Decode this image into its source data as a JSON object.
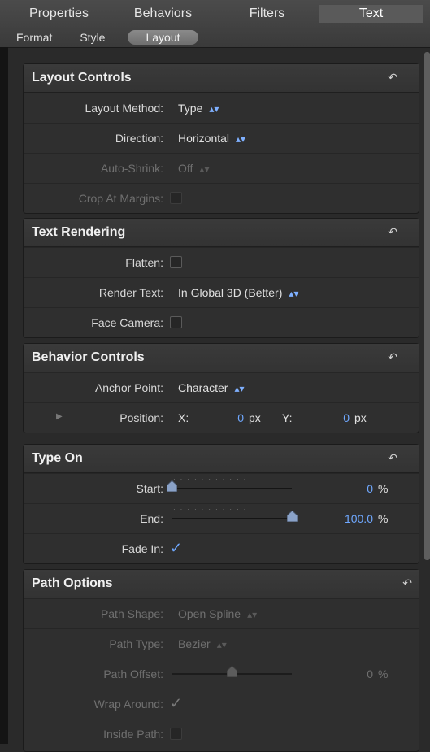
{
  "tabs": [
    "Properties",
    "Behaviors",
    "Filters",
    "Text"
  ],
  "active_tab": 3,
  "subtabs": [
    "Format",
    "Style",
    "Layout"
  ],
  "active_subtab": 2,
  "layout_controls": {
    "title": "Layout Controls",
    "layout_method": {
      "label": "Layout Method:",
      "value": "Type"
    },
    "direction": {
      "label": "Direction:",
      "value": "Horizontal"
    },
    "auto_shrink": {
      "label": "Auto-Shrink:",
      "value": "Off"
    },
    "crop_at_margins": {
      "label": "Crop At Margins:",
      "checked": false
    }
  },
  "text_rendering": {
    "title": "Text Rendering",
    "flatten": {
      "label": "Flatten:",
      "checked": false
    },
    "render_text": {
      "label": "Render Text:",
      "value": "In Global 3D (Better)"
    },
    "face_camera": {
      "label": "Face Camera:",
      "checked": false
    }
  },
  "behavior_controls": {
    "title": "Behavior Controls",
    "anchor_point": {
      "label": "Anchor Point:",
      "value": "Character"
    },
    "position": {
      "label": "Position:",
      "x_label": "X:",
      "x_value": "0",
      "x_unit": "px",
      "y_label": "Y:",
      "y_value": "0",
      "y_unit": "px"
    }
  },
  "type_on": {
    "title": "Type On",
    "start": {
      "label": "Start:",
      "value": "0",
      "unit": "%",
      "fraction": 0.0
    },
    "end": {
      "label": "End:",
      "value": "100.0",
      "unit": "%",
      "fraction": 1.0
    },
    "fade_in": {
      "label": "Fade In:",
      "checked": true
    }
  },
  "path_options": {
    "title": "Path Options",
    "path_shape": {
      "label": "Path Shape:",
      "value": "Open Spline"
    },
    "path_type": {
      "label": "Path Type:",
      "value": "Bezier"
    },
    "path_offset": {
      "label": "Path Offset:",
      "value": "0",
      "unit": "%",
      "fraction": 0.5
    },
    "wrap_around": {
      "label": "Wrap Around:",
      "checked": true
    },
    "inside_path": {
      "label": "Inside Path:",
      "checked": false
    }
  },
  "colors": {
    "accent": "#6fa8ff"
  },
  "icons": {
    "reset": "reset-arrow-icon",
    "popup": "updown-arrows-icon",
    "disclosure": "disclosure-triangle-icon"
  }
}
